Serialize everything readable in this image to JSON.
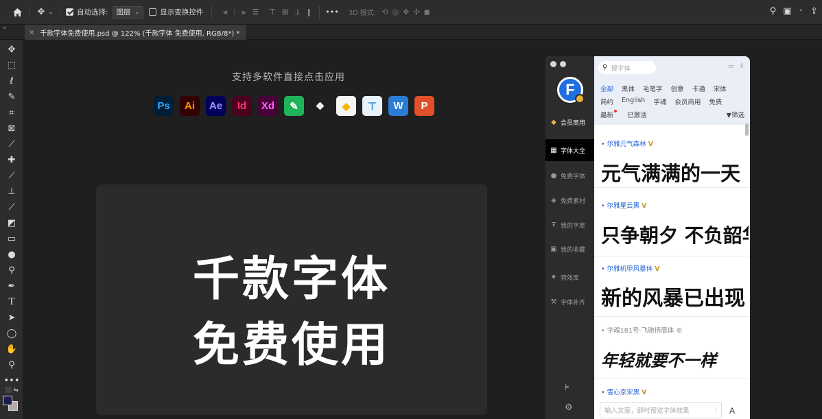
{
  "optbar": {
    "home_icon": "home-icon",
    "auto_select_label": "自动选择:",
    "auto_select_checked": true,
    "auto_select_target": "图层",
    "show_transform_label": "显示变换控件",
    "show_transform_checked": false,
    "more_label": "•••",
    "mode_3d_label": "3D 模式:"
  },
  "tab": {
    "close_label": "×",
    "title": "千款字体免费使用.psd @ 122% (千款字体 免费使用, RGB/8*) *"
  },
  "canvas": {
    "subtitle": "支持多软件直接点击应用",
    "apps": [
      {
        "label": "Ps",
        "bg": "#001e36",
        "fg": "#31a8ff"
      },
      {
        "label": "Ai",
        "bg": "#330000",
        "fg": "#ff9a00"
      },
      {
        "label": "Ae",
        "bg": "#00005b",
        "fg": "#9999ff"
      },
      {
        "label": "Id",
        "bg": "#49021f",
        "fg": "#ff3366"
      },
      {
        "label": "Xd",
        "bg": "#470137",
        "fg": "#ff61f6"
      },
      {
        "label": "",
        "bg": "#1fb35a",
        "fg": "#ffffff",
        "icon": "pen-app-icon"
      },
      {
        "label": "",
        "bg": "#1f1f1f",
        "fg": "#ffffff",
        "icon": "figma-icon"
      },
      {
        "label": "",
        "bg": "#f5f5f5",
        "fg": "#f7b500",
        "icon": "sketch-icon"
      },
      {
        "label": "",
        "bg": "#e8f2fb",
        "fg": "#3a8fd9",
        "icon": "keynote-icon"
      },
      {
        "label": "W",
        "bg": "#2b7cd3",
        "fg": "#ffffff"
      },
      {
        "label": "P",
        "bg": "#e1502b",
        "fg": "#ffffff"
      }
    ],
    "headline_1": "千款字体",
    "headline_2": "免费使用"
  },
  "plugin": {
    "nav": [
      {
        "label": "会员商用",
        "icon": "diamond-icon"
      },
      {
        "label": "字体大全",
        "icon": "grid-icon"
      },
      {
        "label": "免费字体",
        "icon": "free-icon"
      },
      {
        "label": "免费素材",
        "icon": "material-icon"
      },
      {
        "label": "我的字库",
        "icon": "font-library-icon"
      },
      {
        "label": "我的收藏",
        "icon": "favorite-icon"
      },
      {
        "label": "特效库",
        "icon": "effects-icon"
      },
      {
        "label": "字体补齐",
        "icon": "wrench-icon"
      }
    ],
    "search_placeholder": "搜字体",
    "categories_row1": [
      "全部",
      "黑体",
      "毛笔字",
      "创意",
      "卡通",
      "宋体"
    ],
    "categories_row2": [
      "简约",
      "English",
      "字魂",
      "会员商用",
      "免费"
    ],
    "categories_row3": [
      "最新",
      "已激活"
    ],
    "filter_label": "筛选",
    "fonts": [
      {
        "name": "尔雅元气森林",
        "vip": "V",
        "preview": "元气满满的一天"
      },
      {
        "name": "尔雅星云黑",
        "vip": "V",
        "preview": "只争朝夕 不负韶华"
      },
      {
        "name": "尔雅机甲风暴体",
        "vip": "V",
        "preview": "新的风暴已出现"
      },
      {
        "name": "字魂181号-飞驰扬眉体",
        "vip": "©",
        "preview": "年轻就要不一样"
      },
      {
        "name": "雪心京宋黑",
        "vip": "V",
        "preview": ""
      }
    ],
    "input_placeholder": "输入文案，即时预览字体效果",
    "input_a": "A"
  }
}
